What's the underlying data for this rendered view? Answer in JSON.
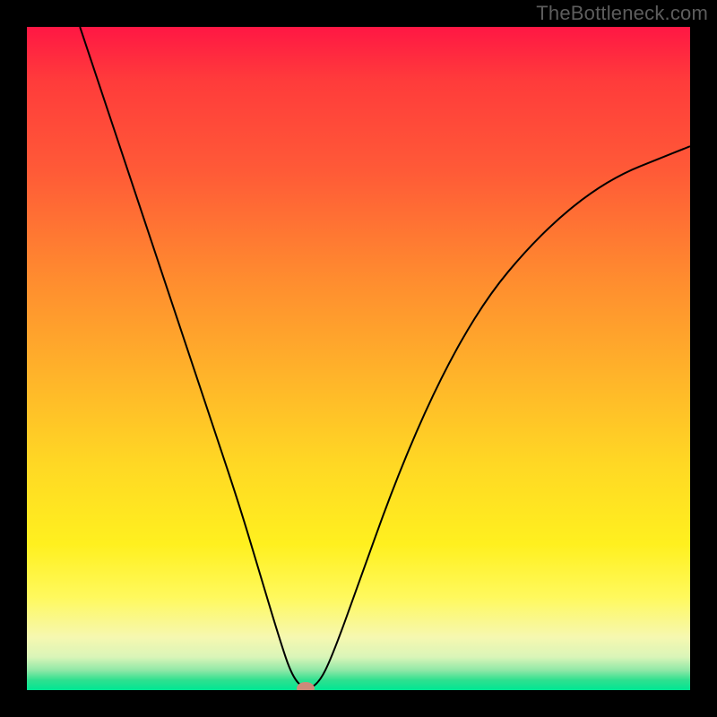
{
  "watermark": "TheBottleneck.com",
  "chart_data": {
    "type": "line",
    "title": "",
    "xlabel": "",
    "ylabel": "",
    "xlim": [
      0,
      100
    ],
    "ylim": [
      0,
      100
    ],
    "gradient_scale": {
      "top": "high",
      "bottom": "low",
      "top_color": "#ff1744",
      "bottom_color": "#00e693"
    },
    "marker": {
      "x": 42,
      "y": 0
    },
    "curve": [
      {
        "x": 8,
        "y": 100
      },
      {
        "x": 12,
        "y": 88
      },
      {
        "x": 16,
        "y": 76
      },
      {
        "x": 20,
        "y": 64
      },
      {
        "x": 24,
        "y": 52
      },
      {
        "x": 28,
        "y": 40
      },
      {
        "x": 32,
        "y": 28
      },
      {
        "x": 35,
        "y": 18
      },
      {
        "x": 38,
        "y": 8
      },
      {
        "x": 40,
        "y": 2
      },
      {
        "x": 42,
        "y": 0
      },
      {
        "x": 44,
        "y": 1
      },
      {
        "x": 46,
        "y": 5
      },
      {
        "x": 50,
        "y": 16
      },
      {
        "x": 55,
        "y": 30
      },
      {
        "x": 60,
        "y": 42
      },
      {
        "x": 65,
        "y": 52
      },
      {
        "x": 70,
        "y": 60
      },
      {
        "x": 75,
        "y": 66
      },
      {
        "x": 80,
        "y": 71
      },
      {
        "x": 85,
        "y": 75
      },
      {
        "x": 90,
        "y": 78
      },
      {
        "x": 95,
        "y": 80
      },
      {
        "x": 100,
        "y": 82
      }
    ]
  },
  "colors": {
    "frame": "#000000",
    "watermark": "#5d5d5d",
    "curve": "#000000",
    "dot": "#cd8b7a"
  }
}
